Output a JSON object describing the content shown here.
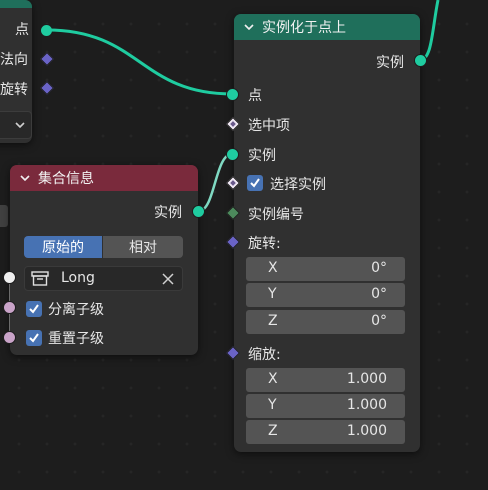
{
  "left_partial": {
    "point_label": "点",
    "normal_label": "法向",
    "rotation_label": "旋转"
  },
  "collection_info_node": {
    "title": "集合信息",
    "output_instances": "实例",
    "tabs": [
      "原始的",
      "相对"
    ],
    "active_tab": "原始的",
    "collection_value": "Long",
    "separate_children_label": "分离子级",
    "separate_children_checked": true,
    "reset_children_label": "重置子级",
    "reset_children_checked": true
  },
  "instance_on_points_node": {
    "title": "实例化于点上",
    "output_instances": "实例",
    "input_points": "点",
    "input_selection": "选中项",
    "input_instance": "实例",
    "pick_instance_label": "选择实例",
    "pick_instance_checked": true,
    "instance_index": "实例编号",
    "rotation_label": "旋转:",
    "rotation": [
      {
        "axis": "X",
        "value": "0°"
      },
      {
        "axis": "Y",
        "value": "0°"
      },
      {
        "axis": "Z",
        "value": "0°"
      }
    ],
    "scale_label": "缩放:",
    "scale": [
      {
        "axis": "X",
        "value": "1.000"
      },
      {
        "axis": "Y",
        "value": "1.000"
      },
      {
        "axis": "Z",
        "value": "1.000"
      }
    ]
  },
  "colors": {
    "geometry_header": "#1f6f5b",
    "input_header": "#7a2a3c",
    "geometry_socket": "#1fcca0",
    "vector_socket": "#6a63c7",
    "checkbox_blue": "#4772b3"
  },
  "icons": [
    "chevron-down-icon",
    "collection-icon",
    "close-icon",
    "checkmark-icon"
  ]
}
